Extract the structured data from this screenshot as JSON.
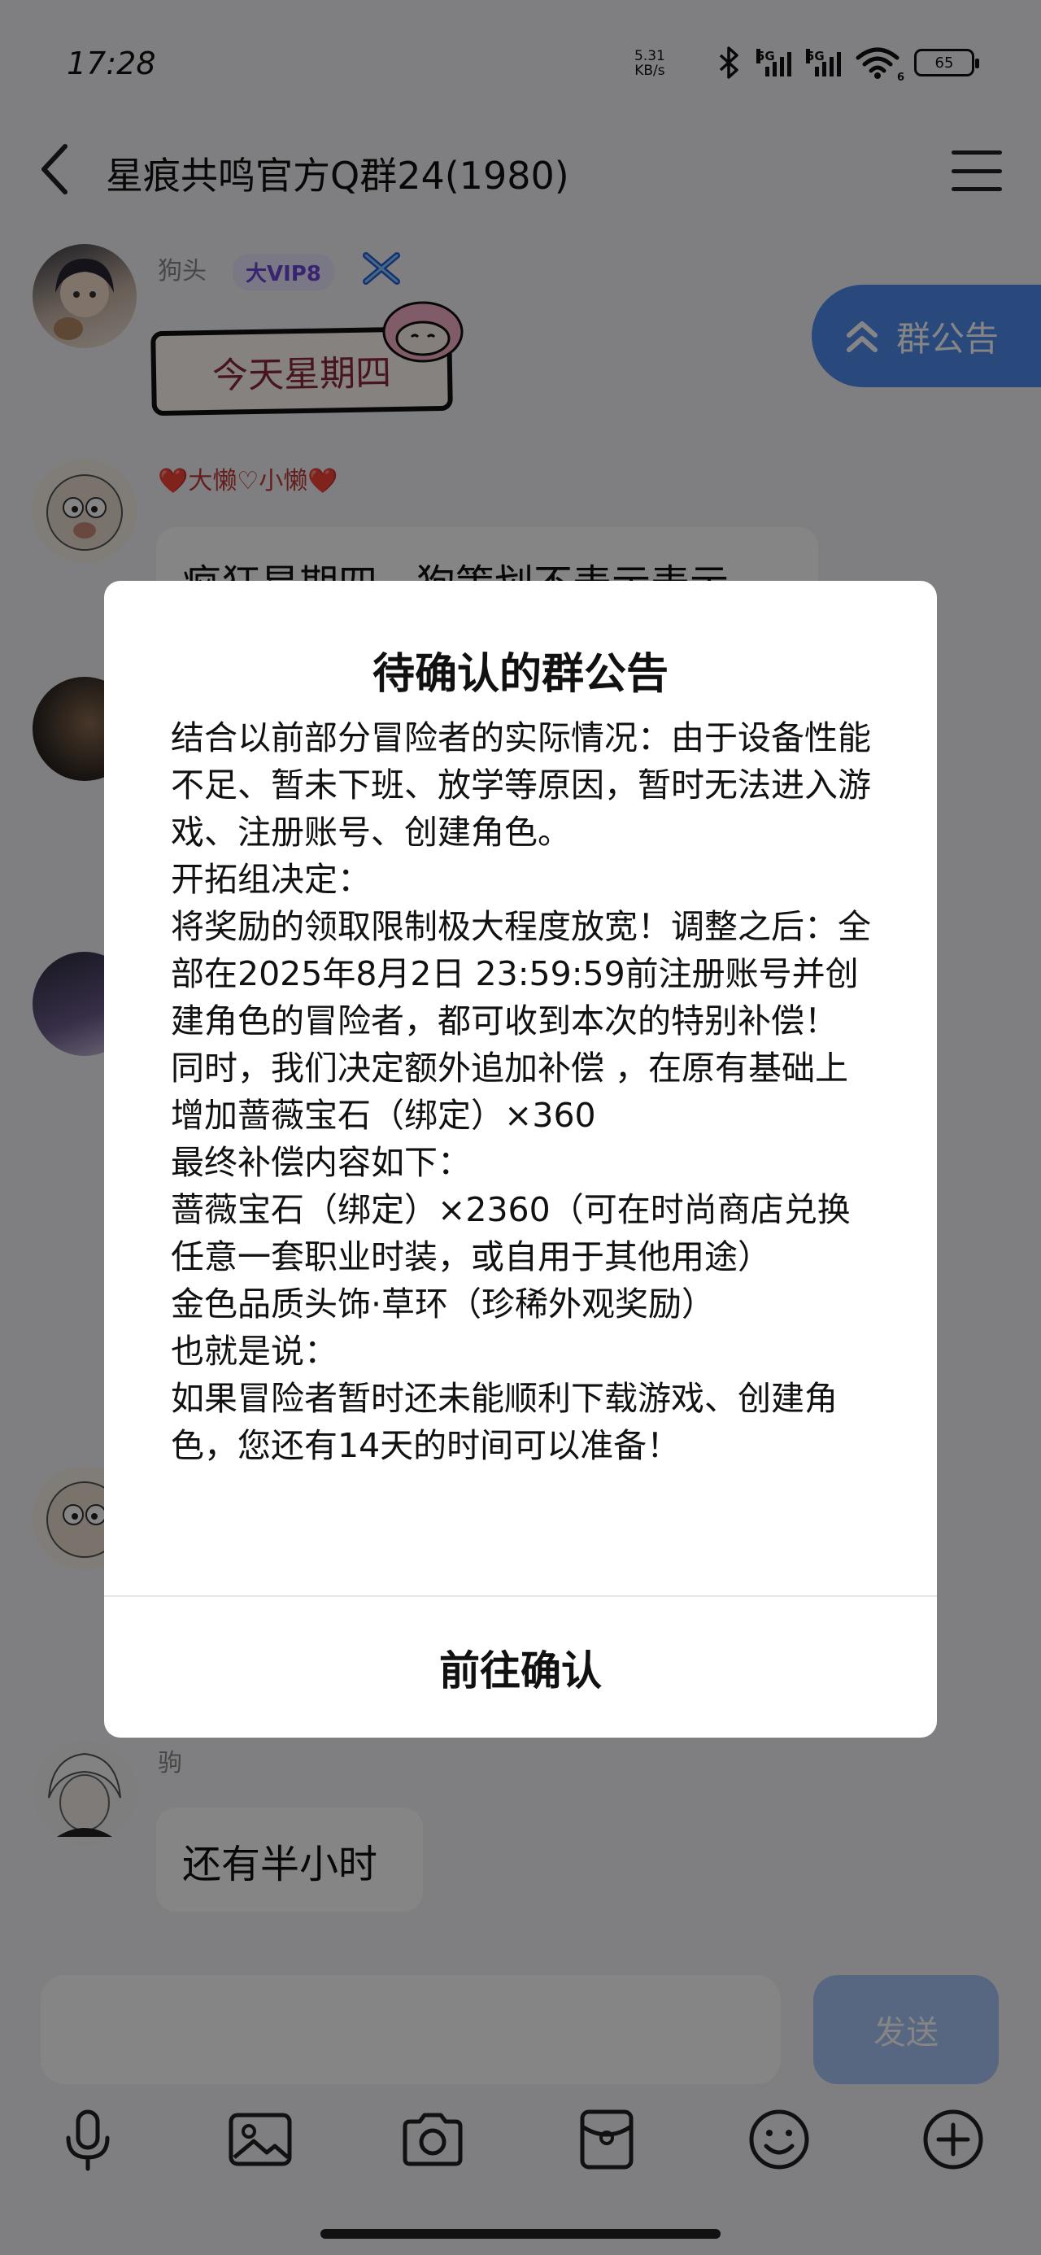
{
  "status_bar": {
    "time": "17:28",
    "net_speed_value": "5.31",
    "net_speed_unit": "KB/s",
    "signal1_label": "5G",
    "signal2_label": "5G",
    "wifi_label": "6",
    "battery": "65"
  },
  "header": {
    "title": "星痕共鸣官方Q群24(1980)"
  },
  "chat": {
    "messages": [
      {
        "nickname": "狗头",
        "vip_label": "大VIP8",
        "sticker_text": "今天星期四"
      },
      {
        "nickname": "❤️大懒♡小懒❤️",
        "text": "疯狂星期四，狗策划不表示表示"
      },
      {
        "nickname": "驹",
        "text": "还有半小时"
      }
    ],
    "notice_pill_label": "群公告"
  },
  "composer": {
    "send_label": "发送"
  },
  "toolbar": {
    "icons": [
      "microphone-icon",
      "image-icon",
      "camera-icon",
      "red-packet-icon",
      "emoji-icon",
      "plus-icon"
    ]
  },
  "dialog": {
    "title": "待确认的群公告",
    "paragraphs": [
      "结合以前部分冒险者的实际情况：由于设备性能不足、暂未下班、放学等原因，暂时无法进入游戏、注册账号、创建角色。",
      "开拓组决定：",
      "将奖励的领取限制极大程度放宽！调整之后：全部在2025年8月2日 23:59:59前注册账号并创建角色的冒险者，都可收到本次的特别补偿！",
      "同时，我们决定额外追加补偿 ，在原有基础上增加蔷薇宝石（绑定）×360",
      "最终补偿内容如下：",
      "蔷薇宝石（绑定）×2360（可在时尚商店兑换任意一套职业时装，或自用于其他用途）",
      "金色品质头饰·草环（珍稀外观奖励）",
      "也就是说：",
      "如果冒险者暂时还未能顺利下载游戏、创建角色，您还有14天的时间可以准备！"
    ],
    "confirm_label": "前往确认"
  }
}
